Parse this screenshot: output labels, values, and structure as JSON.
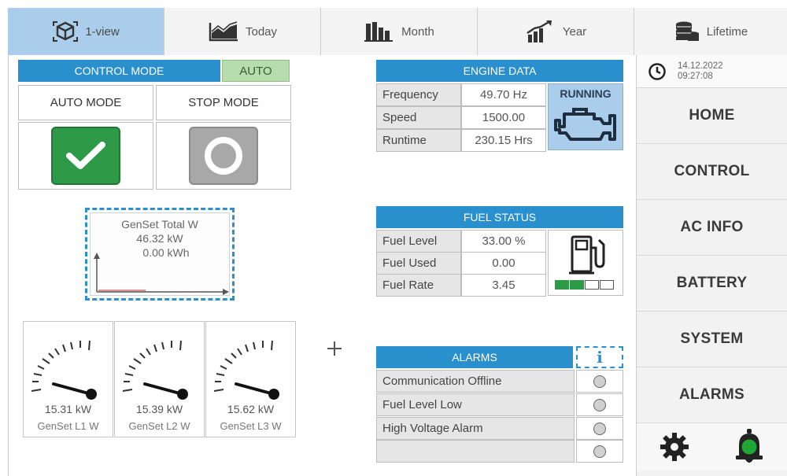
{
  "tabs": [
    {
      "label": "1-view",
      "icon": "cube-icon",
      "active": true
    },
    {
      "label": "Today",
      "icon": "area-chart-icon",
      "active": false
    },
    {
      "label": "Month",
      "icon": "bar-chart-icon",
      "active": false
    },
    {
      "label": "Year",
      "icon": "growth-chart-icon",
      "active": false
    },
    {
      "label": "Lifetime",
      "icon": "coins-stack-icon",
      "active": false
    }
  ],
  "sidebar": {
    "date": "14.12.2022",
    "time": "09:27:08",
    "items": [
      {
        "label": "HOME"
      },
      {
        "label": "CONTROL"
      },
      {
        "label": "AC INFO"
      },
      {
        "label": "BATTERY"
      },
      {
        "label": "SYSTEM"
      },
      {
        "label": "ALARMS"
      }
    ],
    "bell_color": "#1fa534"
  },
  "control_mode": {
    "title": "CONTROL MODE",
    "state": "AUTO",
    "auto_label": "AUTO MODE",
    "stop_label": "STOP MODE"
  },
  "genset_total": {
    "title": "GenSet Total W",
    "power": "46.32 kW",
    "energy": "0.00 kWh"
  },
  "gauges": [
    {
      "value": "15.31 kW",
      "label": "GenSet L1 W"
    },
    {
      "value": "15.39 kW",
      "label": "GenSet L2 W"
    },
    {
      "value": "15.62 kW",
      "label": "GenSet L3 W"
    }
  ],
  "engine_data": {
    "title": "ENGINE DATA",
    "rows": [
      {
        "label": "Frequency",
        "value": "49.70 Hz"
      },
      {
        "label": "Speed",
        "value": "1500.00"
      },
      {
        "label": "Runtime",
        "value": "230.15 Hrs"
      }
    ],
    "status": "RUNNING"
  },
  "fuel_status": {
    "title": "FUEL STATUS",
    "rows": [
      {
        "label": "Fuel Level",
        "value": "33.00 %"
      },
      {
        "label": "Fuel Used",
        "value": "0.00"
      },
      {
        "label": "Fuel Rate",
        "value": "3.45"
      }
    ],
    "level_bars_filled": 2,
    "level_bars_total": 4
  },
  "alarms": {
    "title": "ALARMS",
    "info_glyph": "i",
    "rows": [
      {
        "label": "Communication Offline"
      },
      {
        "label": "Fuel Level Low"
      },
      {
        "label": "High Voltage Alarm"
      },
      {
        "label": ""
      }
    ]
  },
  "colors": {
    "header_blue": "#2a8fcd",
    "active_tab": "#a9cdea",
    "ok_green": "#2e9a47",
    "auto_badge": "#b7dcae"
  }
}
